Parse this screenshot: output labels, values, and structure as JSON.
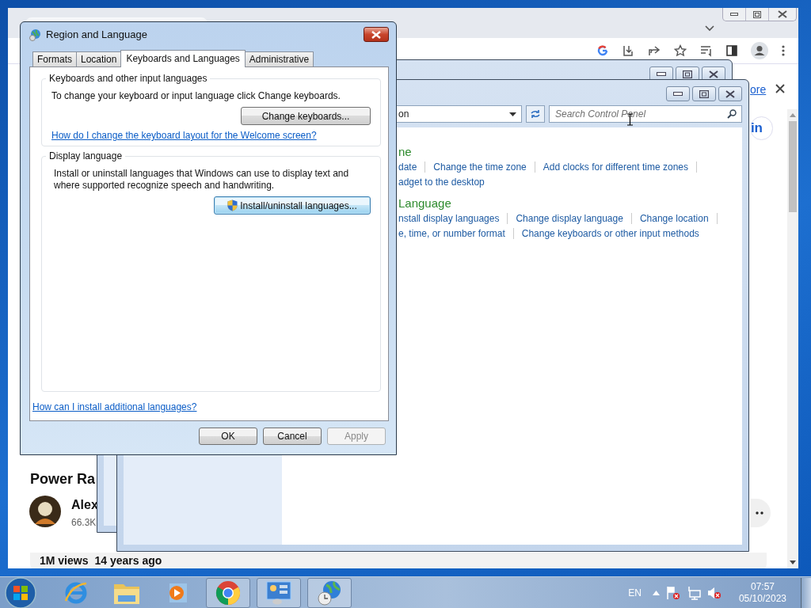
{
  "browser": {
    "banner_link": "ore",
    "sign_in": "in",
    "video": {
      "title": "Power Ra",
      "channel": "Alex",
      "subscribers": "66.3K",
      "views": "1M views",
      "age": "14 years ago"
    }
  },
  "control_panel": {
    "address": "on",
    "search": {
      "placeholder": "Search Control Panel"
    },
    "sections": [
      {
        "heading": "ne",
        "rows": [
          [
            "date",
            "Change the time zone",
            "Add clocks for different time zones"
          ],
          [
            "adget to the desktop"
          ]
        ]
      },
      {
        "heading": "Language",
        "rows": [
          [
            "nstall display languages",
            "Change display language",
            "Change location"
          ],
          [
            "e, time, or number format",
            "Change keyboards or other input methods"
          ]
        ]
      }
    ]
  },
  "dialog": {
    "title": "Region and Language",
    "tabs": [
      {
        "label": "Formats",
        "selected": false
      },
      {
        "label": "Location",
        "selected": false
      },
      {
        "label": "Keyboards and Languages",
        "selected": true
      },
      {
        "label": "Administrative",
        "selected": false
      }
    ],
    "groups": [
      {
        "label": "Keyboards and other input languages",
        "text": "To change your keyboard or input language click Change keyboards.",
        "button": {
          "label": "Change keyboards...",
          "shield": false,
          "focused": false
        },
        "link": "How do I change the keyboard layout for the Welcome screen?"
      },
      {
        "label": "Display language",
        "text": "Install or uninstall languages that Windows can use to display text and where supported recognize speech and handwriting.",
        "button": {
          "label": "Install/uninstall languages...",
          "shield": true,
          "focused": true
        }
      }
    ],
    "footer_link": "How can I install additional languages?",
    "buttons": [
      {
        "label": "OK",
        "disabled": false
      },
      {
        "label": "Cancel",
        "disabled": false
      },
      {
        "label": "Apply",
        "disabled": true
      }
    ]
  },
  "taskbar": {
    "apps": [
      {
        "kind": "ie",
        "open": false
      },
      {
        "kind": "folder",
        "open": false
      },
      {
        "kind": "media",
        "open": false
      },
      {
        "kind": "chrome",
        "open": true
      },
      {
        "kind": "control_panel",
        "open": true
      },
      {
        "kind": "globe_clock",
        "open": true
      }
    ],
    "language": "EN",
    "time": "07:57",
    "date": "05/10/2023"
  }
}
